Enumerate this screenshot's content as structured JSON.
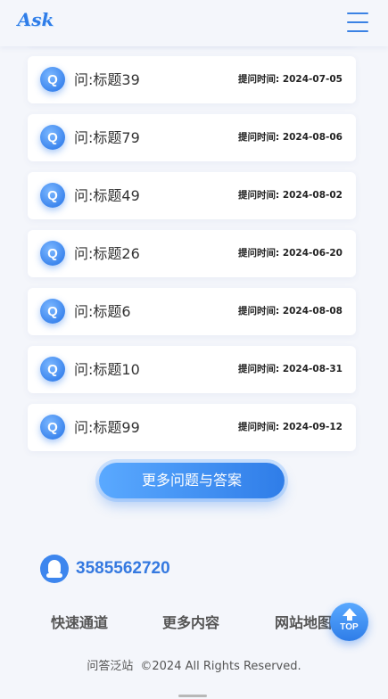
{
  "header": {
    "logo_text": "Ask"
  },
  "questions": [
    {
      "title": "问:标题39",
      "time": "提问时间: 2024-07-05"
    },
    {
      "title": "问:标题79",
      "time": "提问时间: 2024-08-06"
    },
    {
      "title": "问:标题49",
      "time": "提问时间: 2024-08-02"
    },
    {
      "title": "问:标题26",
      "time": "提问时间: 2024-06-20"
    },
    {
      "title": "问:标题6",
      "time": "提问时间: 2024-08-08"
    },
    {
      "title": "问:标题10",
      "time": "提问时间: 2024-08-31"
    },
    {
      "title": "问:标题99",
      "time": "提问时间: 2024-09-12"
    }
  ],
  "q_icon_letter": "Q",
  "more_button_label": "更多问题与答案",
  "contact": {
    "qq_number": "3585562720"
  },
  "footer": {
    "links": [
      "快速通道",
      "更多内容",
      "网站地图"
    ],
    "site_name": "问答泛站",
    "copyright": "©2024 All Rights Reserved."
  },
  "back_to_top_label": "TOP",
  "colors": {
    "accent": "#3d86ee",
    "background": "#f4f6fb"
  }
}
